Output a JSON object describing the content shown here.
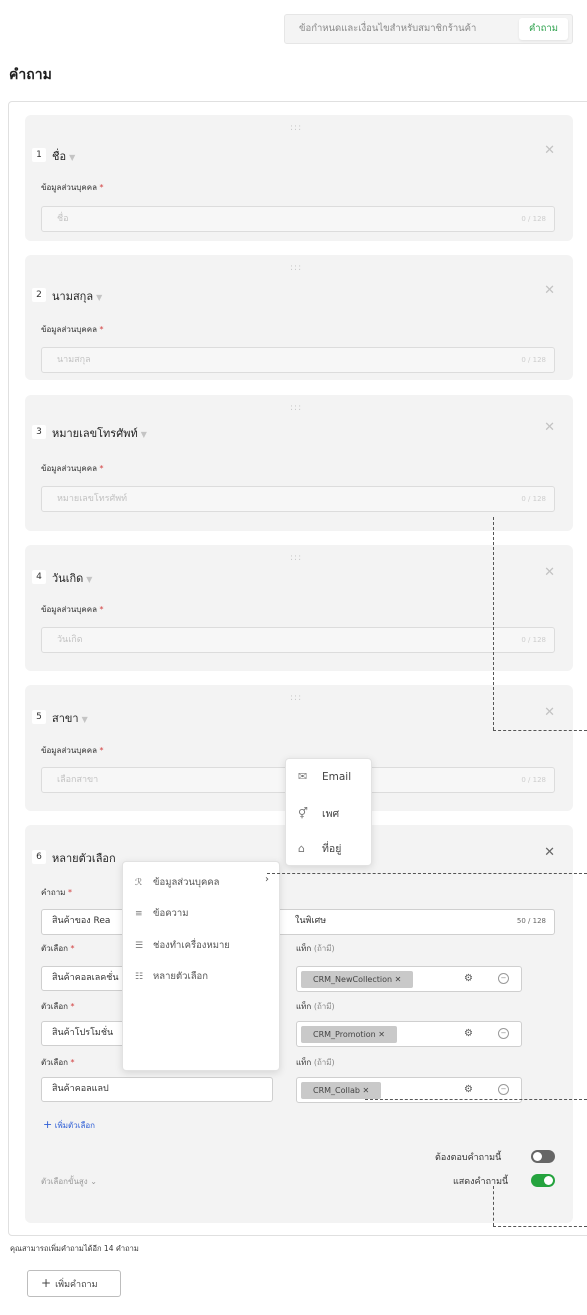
{
  "tabs": {
    "terms": "ข้อกำหนดและเงื่อนไขสำหรับสมาชิกร้านค้า",
    "questions": "คำถาม"
  },
  "page_title": "คำถาม",
  "cards": [
    {
      "num": "1",
      "title": "ชื่อ",
      "field_label": "ข้อมูลส่วนบุคคล",
      "placeholder": "ชื่อ",
      "count": "0 / 128"
    },
    {
      "num": "2",
      "title": "นามสกุล",
      "field_label": "ข้อมูลส่วนบุคคล",
      "placeholder": "นามสกุล",
      "count": "0 / 128"
    },
    {
      "num": "3",
      "title": "หมายเลขโทรศัพท์",
      "field_label": "ข้อมูลส่วนบุคคล",
      "placeholder": "หมายเลขโทรศัพท์",
      "count": "0 / 128"
    },
    {
      "num": "4",
      "title": "วันเกิด",
      "field_label": "ข้อมูลส่วนบุคคล",
      "placeholder": "วันเกิด",
      "count": "0 / 128"
    },
    {
      "num": "5",
      "title": "สาขา",
      "field_label": "ข้อมูลส่วนบุคคล",
      "placeholder": "เลือกสาขา",
      "count": "0 / 128"
    }
  ],
  "q6": {
    "num": "6",
    "title": "หลายตัวเลือก",
    "question_label": "คำถาม",
    "question_value": "สินค้าของ Rea",
    "question_value_tail": "ในพิเศษ",
    "question_count": "50 / 128",
    "options": [
      {
        "label": "ตัวเลือก",
        "value": "สินค้าคอลเลคชั่น",
        "tag_label": "แท็ก",
        "tag_optional": "(ถ้ามี)",
        "tag": "CRM_NewCollection"
      },
      {
        "label": "ตัวเลือก",
        "value": "สินค้าโปรโมชั่น",
        "tag_label": "แท็ก",
        "tag_optional": "(ถ้ามี)",
        "tag": "CRM_Promotion"
      },
      {
        "label": "ตัวเลือก",
        "value": "สินค้าคอลแลป",
        "tag_label": "แท็ก",
        "tag_optional": "(ถ้ามี)",
        "tag": "CRM_Collab"
      }
    ],
    "add_option": "เพิ่มตัวเลือก",
    "advanced": "ตัวเลือกขั้นสูง",
    "required_toggle": {
      "label": "ต้องตอบคำถามนี้",
      "on": false
    },
    "show_toggle": {
      "label": "แสดงคำถามนี้",
      "on": true
    }
  },
  "type_menu": {
    "items": [
      {
        "icon": "person-info-icon",
        "label": "ข้อมูลส่วนบุคคล"
      },
      {
        "icon": "text-lines-icon",
        "label": "ข้อความ"
      },
      {
        "icon": "checkbox-list-icon",
        "label": "ช่องทำเครื่องหมาย"
      },
      {
        "icon": "multi-choice-icon",
        "label": "หลายตัวเลือก"
      }
    ]
  },
  "submenu": {
    "items": [
      {
        "icon": "mail-icon",
        "label": "Email"
      },
      {
        "icon": "gender-icon",
        "label": "เพศ"
      },
      {
        "icon": "home-icon",
        "label": "ที่อยู่"
      }
    ]
  },
  "remaining_text": "คุณสามารถเพิ่มคำถามได้อีก 14 คำถาม",
  "add_question": "เพิ่มคำถาม",
  "colors": {
    "accent_green": "#25a33e",
    "link_blue": "#2f5fd6",
    "required_red": "#d23c3c"
  }
}
